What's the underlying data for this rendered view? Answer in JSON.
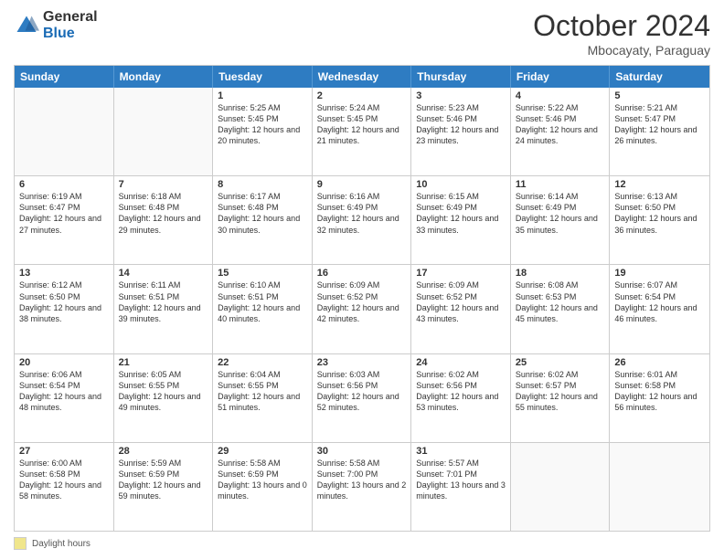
{
  "logo": {
    "general": "General",
    "blue": "Blue"
  },
  "header": {
    "month": "October 2024",
    "location": "Mbocayaty, Paraguay"
  },
  "days_of_week": [
    "Sunday",
    "Monday",
    "Tuesday",
    "Wednesday",
    "Thursday",
    "Friday",
    "Saturday"
  ],
  "weeks": [
    [
      {
        "day": "",
        "text": ""
      },
      {
        "day": "",
        "text": ""
      },
      {
        "day": "1",
        "text": "Sunrise: 5:25 AM\nSunset: 5:45 PM\nDaylight: 12 hours and 20 minutes."
      },
      {
        "day": "2",
        "text": "Sunrise: 5:24 AM\nSunset: 5:45 PM\nDaylight: 12 hours and 21 minutes."
      },
      {
        "day": "3",
        "text": "Sunrise: 5:23 AM\nSunset: 5:46 PM\nDaylight: 12 hours and 23 minutes."
      },
      {
        "day": "4",
        "text": "Sunrise: 5:22 AM\nSunset: 5:46 PM\nDaylight: 12 hours and 24 minutes."
      },
      {
        "day": "5",
        "text": "Sunrise: 5:21 AM\nSunset: 5:47 PM\nDaylight: 12 hours and 26 minutes."
      }
    ],
    [
      {
        "day": "6",
        "text": "Sunrise: 6:19 AM\nSunset: 6:47 PM\nDaylight: 12 hours and 27 minutes."
      },
      {
        "day": "7",
        "text": "Sunrise: 6:18 AM\nSunset: 6:48 PM\nDaylight: 12 hours and 29 minutes."
      },
      {
        "day": "8",
        "text": "Sunrise: 6:17 AM\nSunset: 6:48 PM\nDaylight: 12 hours and 30 minutes."
      },
      {
        "day": "9",
        "text": "Sunrise: 6:16 AM\nSunset: 6:49 PM\nDaylight: 12 hours and 32 minutes."
      },
      {
        "day": "10",
        "text": "Sunrise: 6:15 AM\nSunset: 6:49 PM\nDaylight: 12 hours and 33 minutes."
      },
      {
        "day": "11",
        "text": "Sunrise: 6:14 AM\nSunset: 6:49 PM\nDaylight: 12 hours and 35 minutes."
      },
      {
        "day": "12",
        "text": "Sunrise: 6:13 AM\nSunset: 6:50 PM\nDaylight: 12 hours and 36 minutes."
      }
    ],
    [
      {
        "day": "13",
        "text": "Sunrise: 6:12 AM\nSunset: 6:50 PM\nDaylight: 12 hours and 38 minutes."
      },
      {
        "day": "14",
        "text": "Sunrise: 6:11 AM\nSunset: 6:51 PM\nDaylight: 12 hours and 39 minutes."
      },
      {
        "day": "15",
        "text": "Sunrise: 6:10 AM\nSunset: 6:51 PM\nDaylight: 12 hours and 40 minutes."
      },
      {
        "day": "16",
        "text": "Sunrise: 6:09 AM\nSunset: 6:52 PM\nDaylight: 12 hours and 42 minutes."
      },
      {
        "day": "17",
        "text": "Sunrise: 6:09 AM\nSunset: 6:52 PM\nDaylight: 12 hours and 43 minutes."
      },
      {
        "day": "18",
        "text": "Sunrise: 6:08 AM\nSunset: 6:53 PM\nDaylight: 12 hours and 45 minutes."
      },
      {
        "day": "19",
        "text": "Sunrise: 6:07 AM\nSunset: 6:54 PM\nDaylight: 12 hours and 46 minutes."
      }
    ],
    [
      {
        "day": "20",
        "text": "Sunrise: 6:06 AM\nSunset: 6:54 PM\nDaylight: 12 hours and 48 minutes."
      },
      {
        "day": "21",
        "text": "Sunrise: 6:05 AM\nSunset: 6:55 PM\nDaylight: 12 hours and 49 minutes."
      },
      {
        "day": "22",
        "text": "Sunrise: 6:04 AM\nSunset: 6:55 PM\nDaylight: 12 hours and 51 minutes."
      },
      {
        "day": "23",
        "text": "Sunrise: 6:03 AM\nSunset: 6:56 PM\nDaylight: 12 hours and 52 minutes."
      },
      {
        "day": "24",
        "text": "Sunrise: 6:02 AM\nSunset: 6:56 PM\nDaylight: 12 hours and 53 minutes."
      },
      {
        "day": "25",
        "text": "Sunrise: 6:02 AM\nSunset: 6:57 PM\nDaylight: 12 hours and 55 minutes."
      },
      {
        "day": "26",
        "text": "Sunrise: 6:01 AM\nSunset: 6:58 PM\nDaylight: 12 hours and 56 minutes."
      }
    ],
    [
      {
        "day": "27",
        "text": "Sunrise: 6:00 AM\nSunset: 6:58 PM\nDaylight: 12 hours and 58 minutes."
      },
      {
        "day": "28",
        "text": "Sunrise: 5:59 AM\nSunset: 6:59 PM\nDaylight: 12 hours and 59 minutes."
      },
      {
        "day": "29",
        "text": "Sunrise: 5:58 AM\nSunset: 6:59 PM\nDaylight: 13 hours and 0 minutes."
      },
      {
        "day": "30",
        "text": "Sunrise: 5:58 AM\nSunset: 7:00 PM\nDaylight: 13 hours and 2 minutes."
      },
      {
        "day": "31",
        "text": "Sunrise: 5:57 AM\nSunset: 7:01 PM\nDaylight: 13 hours and 3 minutes."
      },
      {
        "day": "",
        "text": ""
      },
      {
        "day": "",
        "text": ""
      }
    ]
  ],
  "footer": {
    "label": "Daylight hours"
  }
}
